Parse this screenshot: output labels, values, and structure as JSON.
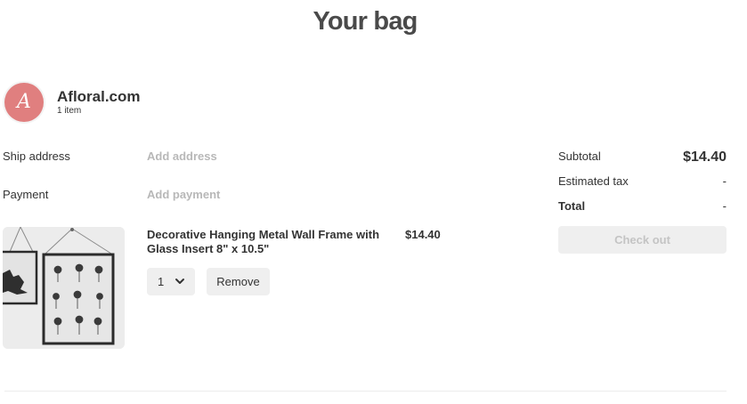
{
  "page": {
    "title": "Your bag"
  },
  "store": {
    "logo_letter": "A",
    "logo_color": "#e07f7f",
    "name": "Afloral.com",
    "item_count": "1 item"
  },
  "shipping": {
    "label": "Ship address",
    "action": "Add address"
  },
  "payment": {
    "label": "Payment",
    "action": "Add payment"
  },
  "item": {
    "name": "Decorative Hanging Metal Wall Frame with Glass Insert 8\" x 10.5\"",
    "price": "$14.40",
    "quantity": "1",
    "remove_label": "Remove",
    "image_icon": "framed-pressed-flowers-photo"
  },
  "summary": {
    "subtotal_label": "Subtotal",
    "subtotal_value": "$14.40",
    "tax_label": "Estimated tax",
    "tax_value": "-",
    "total_label": "Total",
    "total_value": "-",
    "checkout_label": "Check out"
  }
}
